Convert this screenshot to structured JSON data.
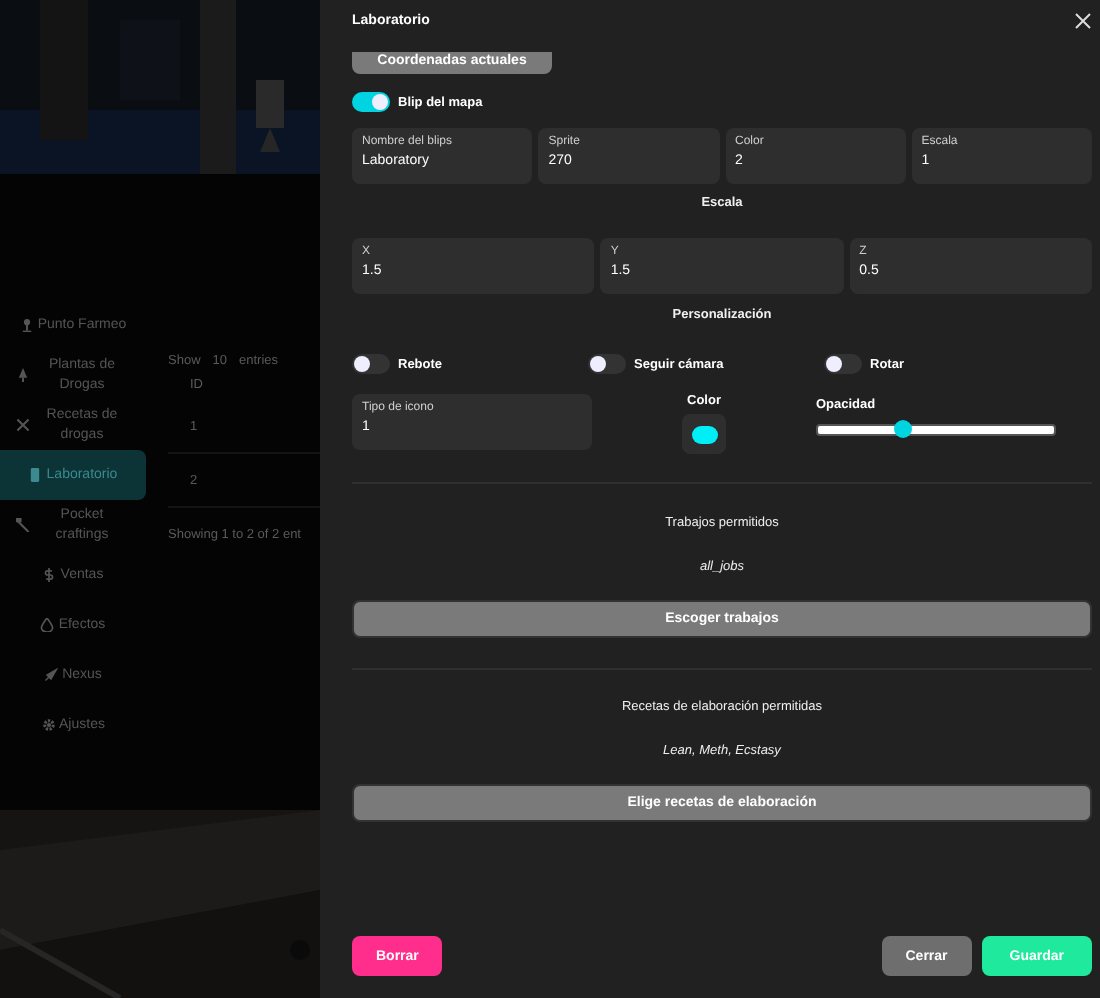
{
  "sidebar": {
    "items": [
      {
        "label": "Punto Farmeo",
        "selected": false
      },
      {
        "label": "Plantas de Drogas",
        "selected": false
      },
      {
        "label": "Recetas de drogas",
        "selected": false
      },
      {
        "label": "Laboratorio",
        "selected": true
      },
      {
        "label": "Pocket craftings",
        "selected": false
      },
      {
        "label": "Ventas",
        "selected": false
      },
      {
        "label": "Efectos",
        "selected": false
      },
      {
        "label": "Nexus",
        "selected": false
      },
      {
        "label": "Ajustes",
        "selected": false
      }
    ]
  },
  "table": {
    "length_before": "Show",
    "length_value": "10",
    "length_after": "entries",
    "columns": [
      "ID"
    ],
    "rows": [
      "1",
      "2"
    ],
    "info": "Showing 1 to 2 of 2 ent"
  },
  "drawer": {
    "title": "Laboratorio",
    "coordinates_button": "Coordenadas actuales",
    "map_blip": {
      "label": "Blip del mapa",
      "on": true
    },
    "blip_fields": [
      {
        "label": "Nombre del blips",
        "value": "Laboratory"
      },
      {
        "label": "Sprite",
        "value": "270"
      },
      {
        "label": "Color",
        "value": "2"
      },
      {
        "label": "Escala",
        "value": "1"
      }
    ],
    "scale_heading": "Escala",
    "scale_fields": [
      {
        "label": "X",
        "value": "1.5"
      },
      {
        "label": "Y",
        "value": "1.5"
      },
      {
        "label": "Z",
        "value": "0.5"
      }
    ],
    "customization_heading": "Personalización",
    "toggles": [
      {
        "label": "Rebote",
        "on": false
      },
      {
        "label": "Seguir cámara",
        "on": false
      },
      {
        "label": "Rotar",
        "on": false
      }
    ],
    "icon_type": {
      "label": "Tipo de icono",
      "value": "1"
    },
    "icon_color": {
      "label": "Color",
      "color": "#00eef5"
    },
    "opacity": {
      "label": "Opacidad",
      "level": 0.36
    },
    "jobs": {
      "heading": "Trabajos permitidos",
      "value": "all_jobs",
      "button": "Escoger trabajos"
    },
    "recipes": {
      "heading": "Recetas de elaboración permitidas",
      "value": "Lean, Meth, Ecstasy",
      "button": "Elige recetas de elaboración"
    },
    "footer_buttons": [
      {
        "label": "Borrar",
        "kind": "danger"
      },
      {
        "label": "Cerrar",
        "kind": "secondary"
      },
      {
        "label": "Guardar",
        "kind": "primary"
      }
    ]
  }
}
